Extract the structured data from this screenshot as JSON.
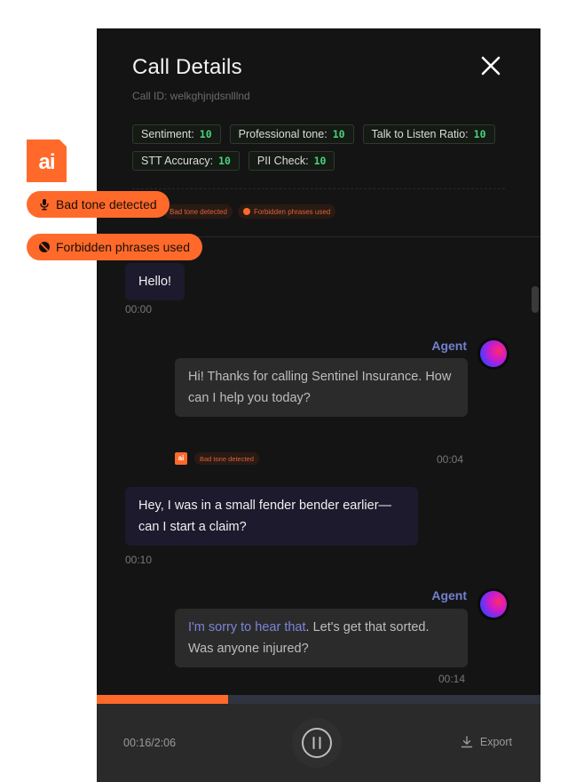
{
  "header": {
    "title": "Call Details",
    "call_id": "Call ID: welkghjnjdsnlllnd"
  },
  "metrics": [
    {
      "label": "Sentiment:",
      "value": "10"
    },
    {
      "label": "Professional tone:",
      "value": "10"
    },
    {
      "label": "Talk to Listen Ratio:",
      "value": "10"
    },
    {
      "label": "STT Accuracy:",
      "value": "10"
    },
    {
      "label": "PII Check:",
      "value": "10"
    }
  ],
  "flags": {
    "bad_tone": "Bad tone detected",
    "forbidden": "Forbidden phrases used"
  },
  "ai_badge": "ai",
  "messages": [
    {
      "role": "user",
      "text": "Hello!",
      "time": "00:00"
    },
    {
      "role": "agent",
      "speaker": "Agent",
      "text": "Hi! Thanks for calling Sentinel Insurance. How can I help you today?",
      "time": "00:04",
      "flag": "Bad tone detected"
    },
    {
      "role": "user",
      "text": "Hey, I was in a small fender bender earlier—can I start a claim?",
      "time": "00:10"
    },
    {
      "role": "agent",
      "speaker": "Agent",
      "highlight": "I'm sorry to hear that",
      "text_rest": ". Let's get that sorted. Was anyone injured?",
      "time": "00:14"
    }
  ],
  "player": {
    "time": "00:16/2:06",
    "progress": 0.2955,
    "export_label": "Export"
  },
  "colors": {
    "accent": "#ff6a2b",
    "agent_name": "#7480cf",
    "metric_value": "#49d17a"
  }
}
